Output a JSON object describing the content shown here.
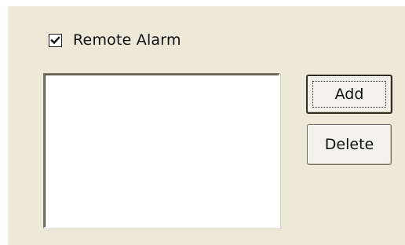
{
  "remote_alarm": {
    "label": "Remote Alarm",
    "checked": true
  },
  "list": {
    "items": []
  },
  "buttons": {
    "add_label": "Add",
    "delete_label": "Delete"
  },
  "icons": {
    "check": "checkmark-icon"
  },
  "colors": {
    "panel_bg": "#ece9d8",
    "list_bg": "#ffffff"
  }
}
